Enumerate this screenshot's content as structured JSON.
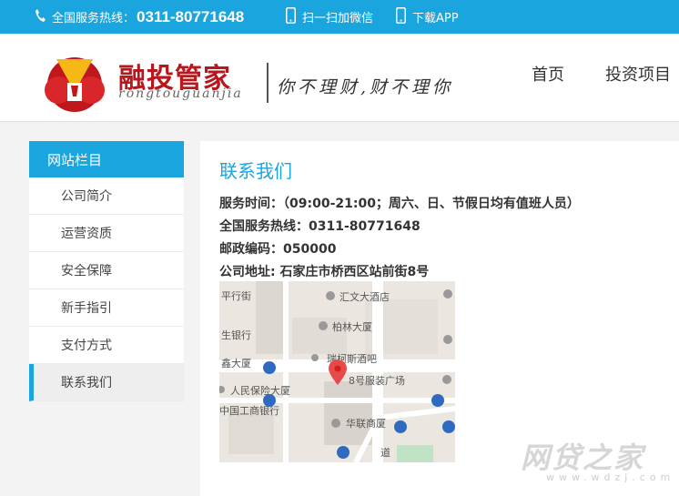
{
  "topbar": {
    "hotline_label": "全国服务热线：",
    "hotline_number": "0311-80771648",
    "wechat": "扫一扫加微信",
    "app": "下载APP"
  },
  "brand": {
    "name": "融投管家",
    "pinyin": "rongtouguanjia",
    "slogan": "你不理财,财不理你"
  },
  "nav": {
    "items": [
      {
        "label": "首页"
      },
      {
        "label": "投资项目"
      }
    ]
  },
  "sidebar": {
    "title": "网站栏目",
    "items": [
      {
        "label": "公司简介"
      },
      {
        "label": "运营资质"
      },
      {
        "label": "安全保障"
      },
      {
        "label": "新手指引"
      },
      {
        "label": "支付方式"
      },
      {
        "label": "联系我们"
      }
    ],
    "active_index": 5
  },
  "content": {
    "title": "联系我们",
    "service_time": "服务时间：（09:00-21:00；周六、日、节假日均有值班人员）",
    "hotline": "全国服务热线：0311-80771648",
    "postcode": "邮政编码：050000",
    "address": "公司地址: 石家庄市桥西区站前街8号"
  },
  "map": {
    "labels": {
      "street1": "平行街",
      "hotel": "汇文大酒店",
      "bailin": "柏林大厦",
      "bank": "生银行",
      "bldg": "鑫大厦",
      "bar": "瑞柯斯酒吧",
      "plaza": "8号服装广场",
      "insurance": "人民保险大厦",
      "icbc": "中国工商银行",
      "hualian": "华联商厦",
      "road": "道"
    }
  },
  "watermark": {
    "text": "网贷之家",
    "url": "www.wdzj.com"
  },
  "colors": {
    "accent": "#1aa5de",
    "brand_red": "#b8171d",
    "pin": "#e84a4a"
  }
}
